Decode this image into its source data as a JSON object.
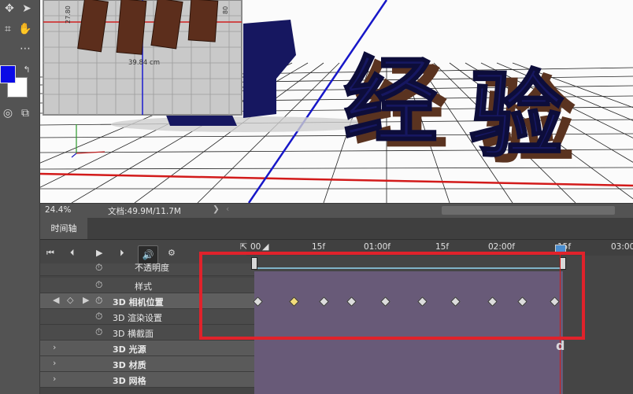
{
  "viewport": {
    "text_3d": [
      "经",
      "验"
    ],
    "measure_vertical": "27.80",
    "measure_vertical_right": "80",
    "measure_horizontal": "39.84 cm"
  },
  "status": {
    "zoom": "24.4%",
    "doc_size": "文档:49.9M/11.7M",
    "arrow": "❯",
    "scroll_left": "‹"
  },
  "timeline": {
    "tab_label": "时间轴",
    "ruler_ticks": [
      "00",
      "15f",
      "01:00f",
      "15f",
      "02:00f",
      "15f",
      "03:00"
    ],
    "rows": [
      {
        "label": "不透明度",
        "type": "property"
      },
      {
        "label": "样式",
        "type": "property"
      },
      {
        "label": "3D 相机位置",
        "type": "property-selected"
      },
      {
        "label": "3D 渲染设置",
        "type": "property"
      },
      {
        "label": "3D 横截面",
        "type": "property"
      },
      {
        "label": "3D 光源",
        "type": "group"
      },
      {
        "label": "3D 材质",
        "type": "group"
      },
      {
        "label": "3D 网格",
        "type": "group"
      }
    ],
    "keyframe_count": 10,
    "active_keyframe_index": 1
  },
  "icons": {
    "first_frame": "⏮",
    "prev_frame": "⏴",
    "play": "▶",
    "next_frame": "⏵",
    "mute": "🔊",
    "settings": "⚙",
    "stopwatch": "⏱",
    "expand": "›",
    "prev_key": "◀",
    "add_key": "◇",
    "next_key": "▶"
  },
  "watermark": "d"
}
